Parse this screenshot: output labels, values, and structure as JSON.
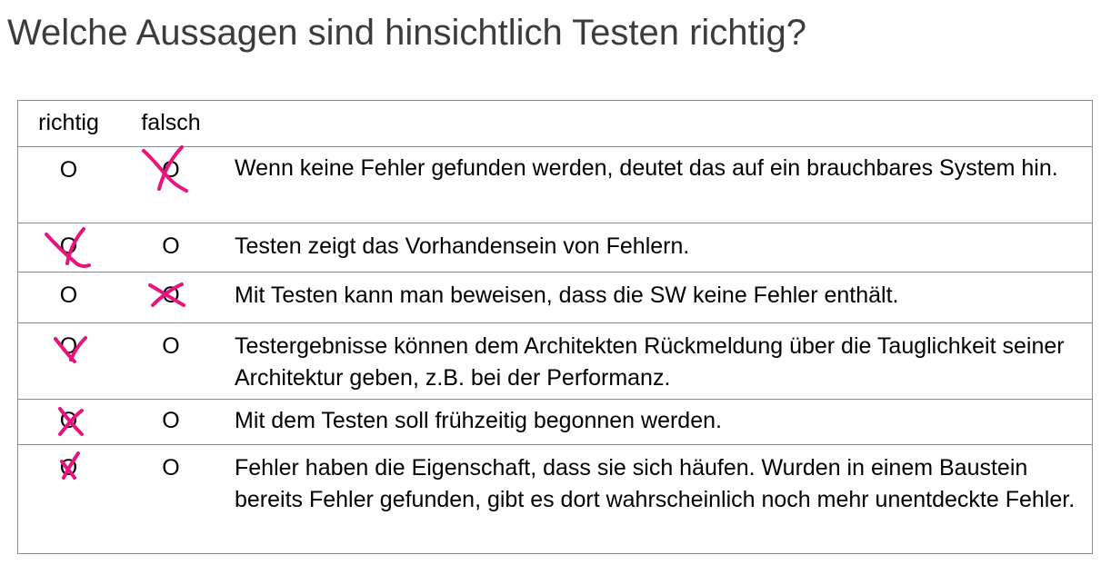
{
  "title": "Welche Aussagen sind hinsichtlich Testen richtig?",
  "table": {
    "headers": {
      "richtig": "richtig",
      "falsch": "falsch"
    },
    "option_symbol": "O",
    "mark_color": "#e8137c",
    "rows": [
      {
        "statement": "Wenn keine Fehler gefunden werden, deutet das auf ein brauchbares System hin.",
        "marked": "falsch"
      },
      {
        "statement": "Testen zeigt das Vorhandensein von Fehlern.",
        "marked": "richtig"
      },
      {
        "statement": "Mit Testen kann man beweisen, dass die SW keine Fehler enthält.",
        "marked": "falsch"
      },
      {
        "statement": "Testergebnisse können dem Architekten Rückmeldung über die Tauglichkeit seiner Architektur geben, z.B. bei der Performanz.",
        "marked": "richtig"
      },
      {
        "statement": "Mit dem Testen soll frühzeitig begonnen werden.",
        "marked": "richtig"
      },
      {
        "statement": "Fehler haben die Eigenschaft, dass sie sich häufen. Wurden in einem Baustein bereits Fehler gefunden, gibt es dort wahrscheinlich noch mehr unentdeckte Fehler.",
        "marked": "richtig"
      }
    ]
  }
}
